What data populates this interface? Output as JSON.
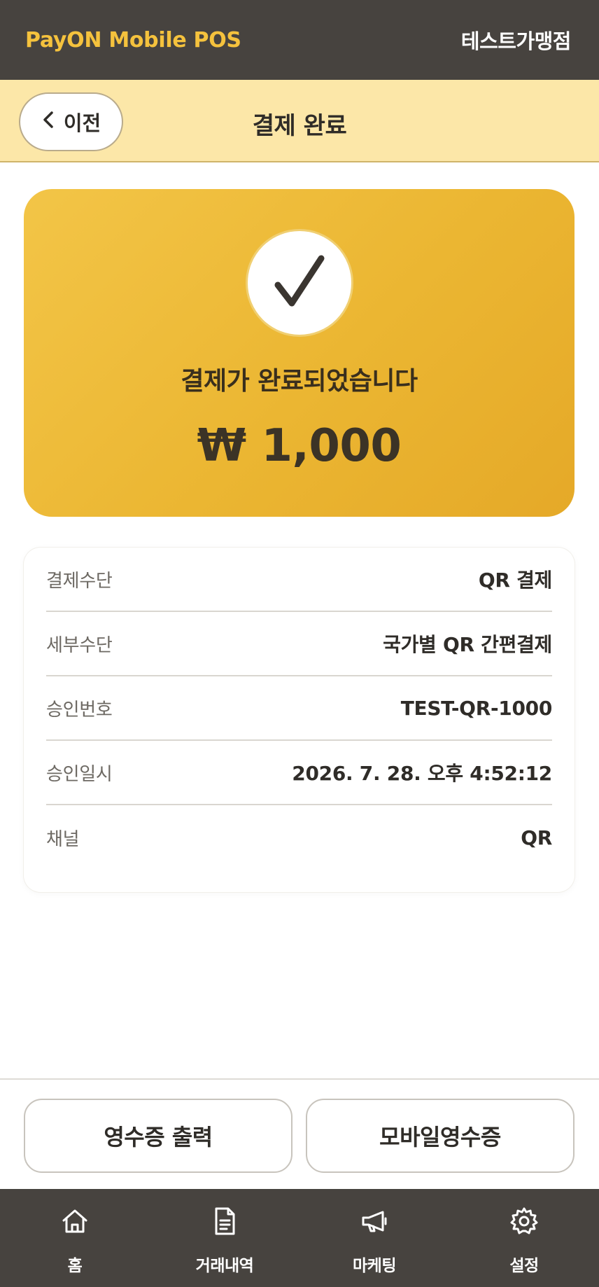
{
  "app_bar": {
    "title": "PayON Mobile POS",
    "store_name": "테스트가맹점"
  },
  "sub_header": {
    "back_label": "이전",
    "title": "결제 완료"
  },
  "success": {
    "message": "결제가 완료되었습니다",
    "amount": "₩ 1,000",
    "icon": "checkmark-icon"
  },
  "details": [
    {
      "label": "결제수단",
      "value": "QR 결제"
    },
    {
      "label": "세부수단",
      "value": "국가별 QR 간편결제"
    },
    {
      "label": "승인번호",
      "value": "TEST-QR-1000"
    },
    {
      "label": "승인일시",
      "value": "2026. 7. 28. 오후 4:52:12"
    },
    {
      "label": "채널",
      "value": "QR"
    }
  ],
  "actions": {
    "print_receipt": "영수증 출력",
    "mobile_receipt": "모바일영수증"
  },
  "bottom_nav": [
    {
      "label": "홈",
      "icon": "home-icon"
    },
    {
      "label": "거래내역",
      "icon": "document-icon"
    },
    {
      "label": "마케팅",
      "icon": "megaphone-icon"
    },
    {
      "label": "설정",
      "icon": "gear-icon"
    }
  ],
  "colors": {
    "app_bar": "#47433f",
    "brand_yellow": "#f5c23d",
    "sub_header": "#fce7a8",
    "card_gradient_start": "#f3c547",
    "card_gradient_end": "#e5a928"
  }
}
